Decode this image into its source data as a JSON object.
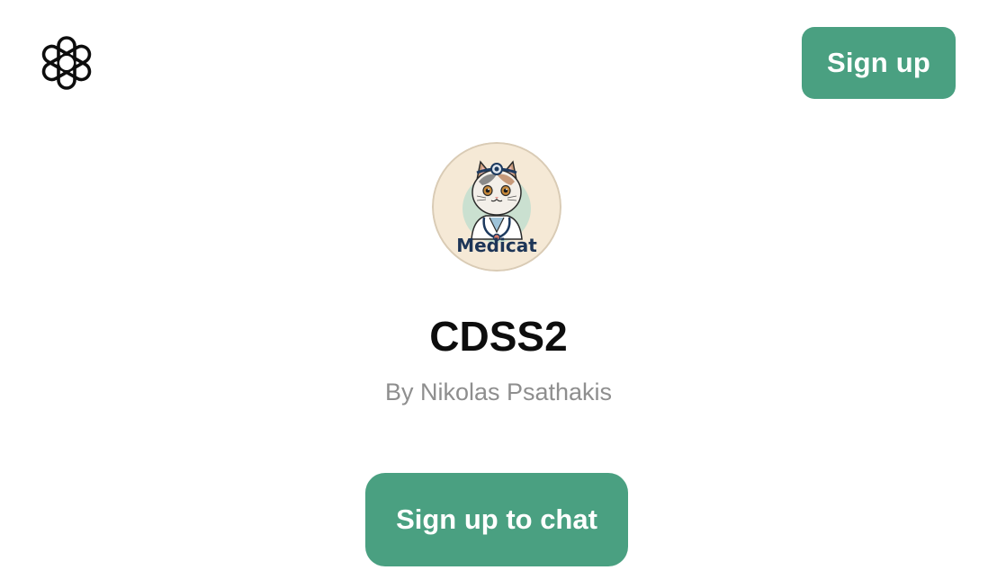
{
  "header": {
    "logo_icon": "openai-logo-icon",
    "signup_label": "Sign up"
  },
  "gpt": {
    "avatar_icon": "medicat-cat-doctor-avatar",
    "avatar_text": "Medicat",
    "name": "CDSS2",
    "author": "By Nikolas Psathakis"
  },
  "cta": {
    "label": "Sign up to chat"
  },
  "colors": {
    "accent": "#4aa081",
    "title": "#0d0d0d",
    "muted": "#8e8e8e",
    "background": "#ffffff"
  }
}
